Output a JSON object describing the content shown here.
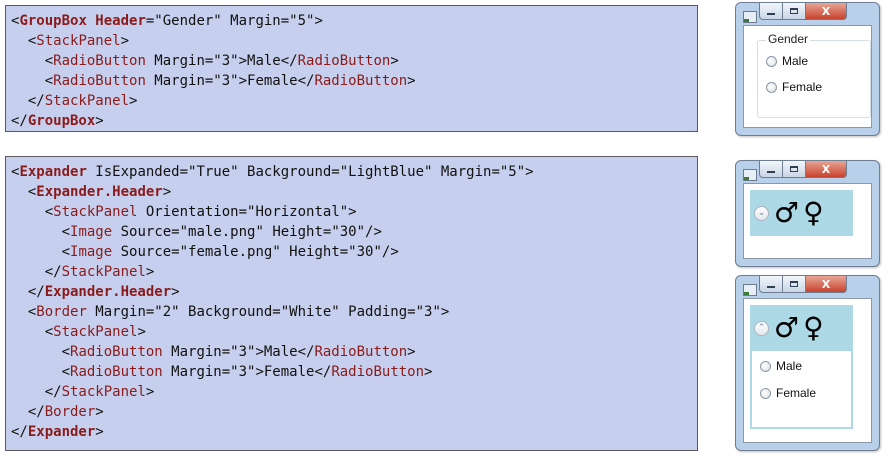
{
  "code1": {
    "lines": [
      [
        "<",
        "GroupBox Header",
        "=\"Gender\" Margin=\"5\">"
      ],
      [
        "  <",
        "StackPanel",
        ">"
      ],
      [
        "    <",
        "RadioButton",
        " Margin=\"3\">Male</",
        "RadioButton",
        ">"
      ],
      [
        "    <",
        "RadioButton",
        " Margin=\"3\">Female</",
        "RadioButton",
        ">"
      ],
      [
        "  </",
        "StackPanel",
        ">"
      ],
      [
        "</",
        "GroupBox",
        ">"
      ]
    ]
  },
  "code2": {
    "lines": [
      [
        "<",
        "Expander",
        " IsExpanded=\"True\" Background=\"LightBlue\" Margin=\"5\">"
      ],
      [
        "  <",
        "Expander.Header",
        ">"
      ],
      [
        "    <",
        "StackPanel",
        " Orientation=\"Horizontal\">"
      ],
      [
        "      <",
        "Image",
        " Source=\"male.png\" Height=\"30\"/>"
      ],
      [
        "      <",
        "Image",
        " Source=\"female.png\" Height=\"30\"/>"
      ],
      [
        "    </",
        "StackPanel",
        ">"
      ],
      [
        "  </",
        "Expander.Header",
        ">"
      ],
      [
        "  <",
        "Border",
        " Margin=\"2\" Background=\"White\" Padding=\"3\">"
      ],
      [
        "    <",
        "StackPanel",
        ">"
      ],
      [
        "      <",
        "RadioButton",
        " Margin=\"3\">Male</",
        "RadioButton",
        ">"
      ],
      [
        "      <",
        "RadioButton",
        " Margin=\"3\">Female</",
        "RadioButton",
        ">"
      ],
      [
        "    </",
        "StackPanel",
        ">"
      ],
      [
        "  </",
        "Border",
        ">"
      ],
      [
        "</",
        "Expander",
        ">"
      ]
    ]
  },
  "window_buttons": {
    "close_label": "X"
  },
  "groupbox": {
    "header": "Gender",
    "option_male": "Male",
    "option_female": "Female"
  },
  "expander": {
    "header_symbols": [
      "♂",
      "♀"
    ],
    "collapsed_chevron": "⌄",
    "expanded_chevron": "⌃",
    "option_male": "Male",
    "option_female": "Female"
  },
  "colors": {
    "code_bg": "#c6d0ee",
    "tag": "#8b1a1a",
    "expander_bg": "#add8e6"
  }
}
